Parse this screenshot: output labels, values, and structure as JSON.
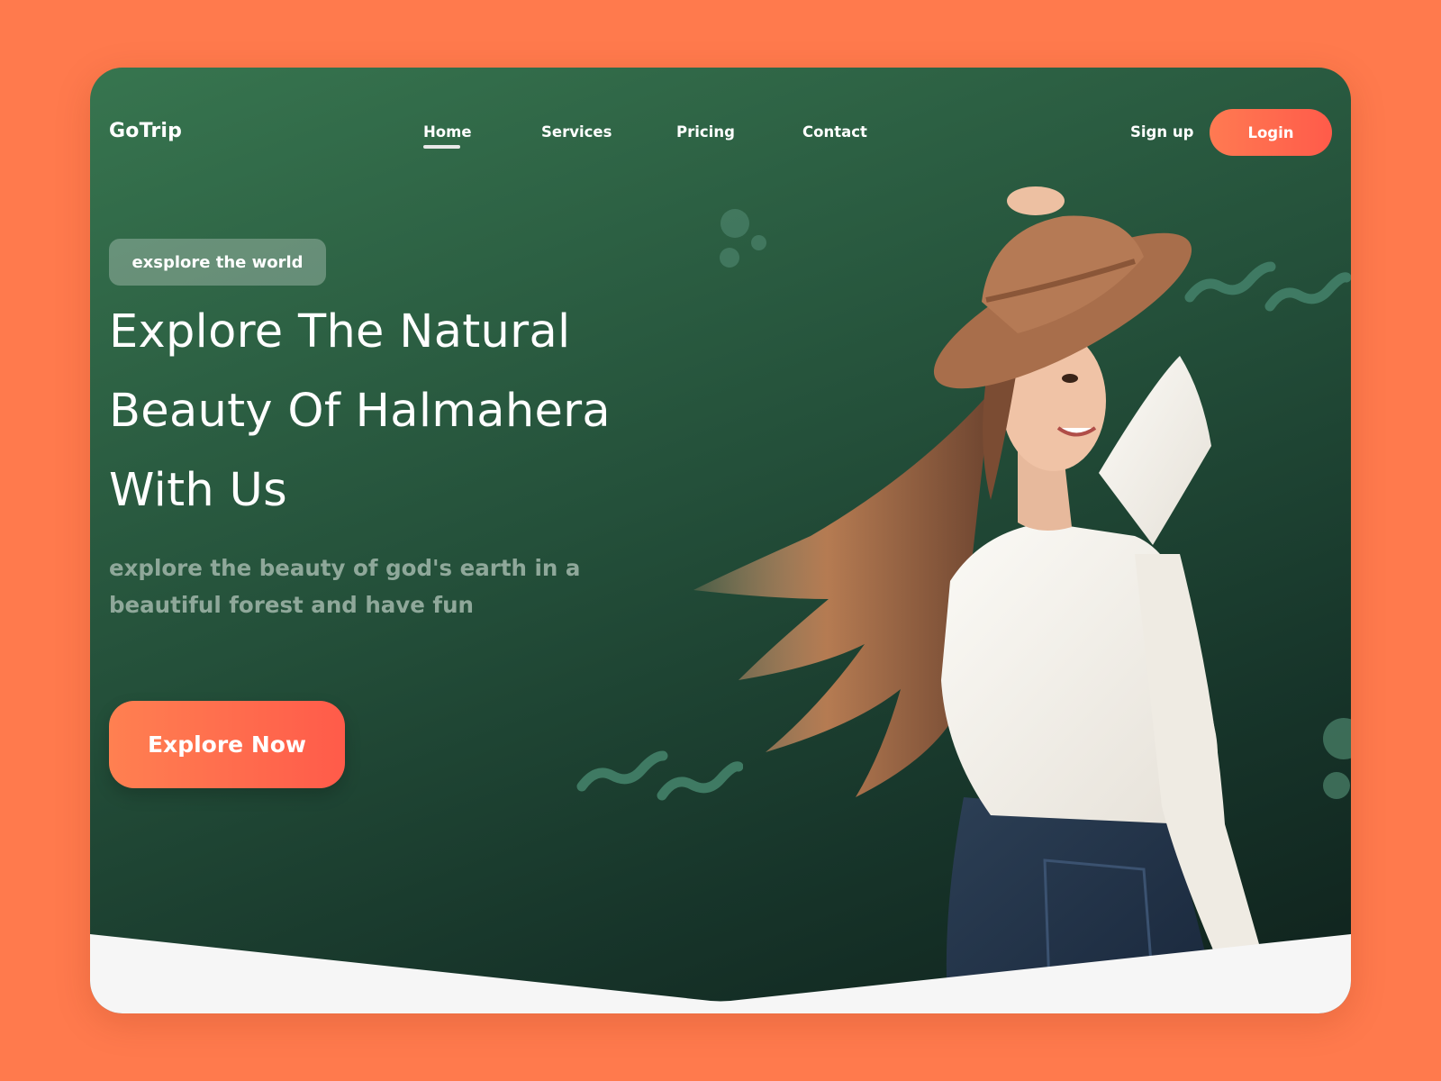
{
  "nav": {
    "logo": "GoTrip",
    "links": [
      "Home",
      "Services",
      "Pricing",
      "Contact"
    ],
    "signup_label": "Sign up",
    "login_label": "Login"
  },
  "hero": {
    "tag": "exsplore the world",
    "headline_lines": [
      "Explore The Natural",
      "Beauty Of Halmahera",
      "With Us"
    ],
    "subtitle": "explore the beauty of god's earth in a beautiful forest and have fun",
    "cta_label": "Explore Now"
  },
  "colors": {
    "background": "#FF7A4D",
    "card_gradient_start": "#37754F",
    "card_gradient_end": "#0F211C",
    "accent": "#FF5B4A"
  }
}
